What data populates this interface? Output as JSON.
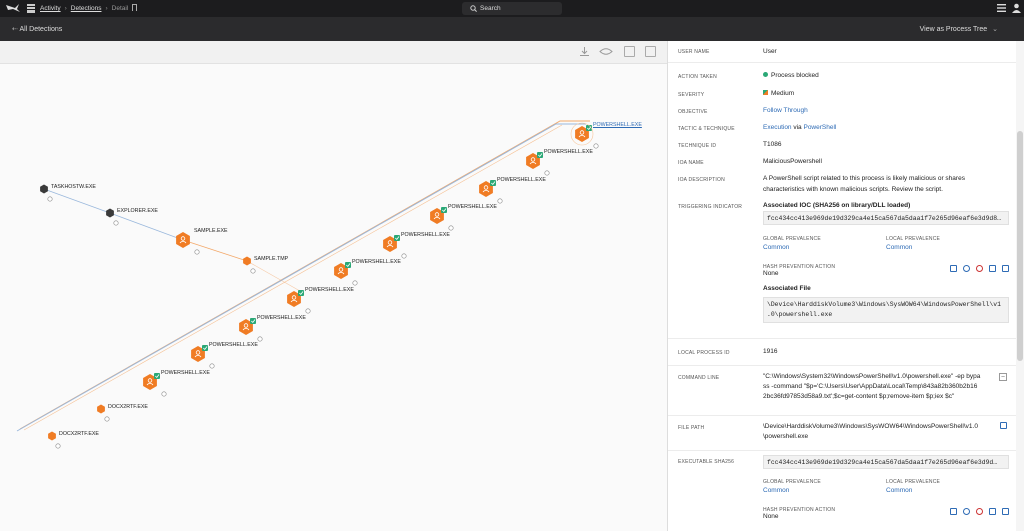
{
  "topbar": {
    "breadcrumb": [
      "Activity",
      "Detections",
      "Detail"
    ],
    "search_label": "Search"
  },
  "subbar": {
    "back_label": "All Detections",
    "view_label": "View as Process Tree"
  },
  "tree": {
    "nodes": [
      {
        "label": "TASKHOSTW.EXE",
        "kind": "gray"
      },
      {
        "label": "EXPLORER.EXE",
        "kind": "gray"
      },
      {
        "label": "SAMPLE.EXE",
        "kind": "orange"
      },
      {
        "label": "SAMPLE.TMP",
        "kind": "orange-small"
      },
      {
        "label": "POWERSHELL.EXE",
        "kind": "orange-check",
        "selected": true
      },
      {
        "label": "POWERSHELL.EXE",
        "kind": "orange-check"
      },
      {
        "label": "POWERSHELL.EXE",
        "kind": "orange-check"
      },
      {
        "label": "POWERSHELL.EXE",
        "kind": "orange-check"
      },
      {
        "label": "POWERSHELL.EXE",
        "kind": "orange-check"
      },
      {
        "label": "POWERSHELL.EXE",
        "kind": "orange-check"
      },
      {
        "label": "POWERSHELL.EXE",
        "kind": "orange-check"
      },
      {
        "label": "POWERSHELL.EXE",
        "kind": "orange-check"
      },
      {
        "label": "POWERSHELL.EXE",
        "kind": "orange-check"
      },
      {
        "label": "POWERSHELL.EXE",
        "kind": "orange-check"
      },
      {
        "label": "DOCX2RTF.EXE",
        "kind": "orange-small"
      },
      {
        "label": "DOCX2RTF.EXE",
        "kind": "orange-small"
      }
    ]
  },
  "details": {
    "user_name": {
      "key": "USER NAME",
      "value": "User"
    },
    "action_taken": {
      "key": "ACTION TAKEN",
      "value": "Process blocked"
    },
    "severity": {
      "key": "SEVERITY",
      "value": "Medium"
    },
    "objective": {
      "key": "OBJECTIVE",
      "value": "Follow Through"
    },
    "tactic": {
      "key": "TACTIC & TECHNIQUE",
      "tactic": "Execution",
      "via": "via",
      "technique": "PowerShell"
    },
    "technique_id": {
      "key": "TECHNIQUE ID",
      "value": "T1086"
    },
    "ioa_name": {
      "key": "IOA NAME",
      "value": "MaliciousPowershell"
    },
    "ioa_description": {
      "key": "IOA DESCRIPTION",
      "line1": "A PowerShell script related to this process is likely malicious or shares",
      "line2": "characteristics with known malicious scripts. Review the script."
    },
    "triggering_indicator": {
      "key": "TRIGGERING INDICATOR",
      "ioc_title": "Associated IOC (SHA256 on library/DLL loaded)",
      "ioc_hash": "fcc434cc413e969de19d329ca4e15ca567da5daa1f7e265d96eaf6e3d9d8…",
      "global_prevalence_label": "GLOBAL PREVALENCE",
      "global_prevalence": "Common",
      "local_prevalence_label": "LOCAL PREVALENCE",
      "local_prevalence": "Common",
      "hash_prevention_label": "HASH PREVENTION ACTION",
      "hash_prevention": "None",
      "assoc_file_title": "Associated File",
      "assoc_file_line1": "\\Device\\HarddiskVolume3\\Windows\\SysWOW64\\WindowsPowerShell\\v1",
      "assoc_file_line2": ".0\\powershell.exe"
    },
    "local_process_id": {
      "key": "LOCAL PROCESS ID",
      "value": "1916"
    },
    "command_line": {
      "key": "COMMAND LINE",
      "line1": "\"C:\\Windows\\System32\\WindowsPowerShell\\v1.0\\powershell.exe\" -ep bypa",
      "line2": "ss -command \"$p='C:\\Users\\User\\AppData\\Local\\Temp\\843a82b360b2b16",
      "line3": "2bc36fd97853d58a9.txt';$c=get-content $p;remove-item $p;iex $c\""
    },
    "file_path": {
      "key": "FILE PATH",
      "line1": "\\Device\\HarddiskVolume3\\Windows\\SysWOW64\\WindowsPowerShell\\v1.0",
      "line2": "\\powershell.exe"
    },
    "executable_sha256": {
      "key": "EXECUTABLE SHA256",
      "hash": "fcc434cc413e969de19d329ca4e15ca567da5daa1f7e265d96eaf6e3d9d…",
      "global_prevalence_label": "GLOBAL PREVALENCE",
      "global_prevalence": "Common",
      "local_prevalence_label": "LOCAL PREVALENCE",
      "local_prevalence": "Common",
      "hash_prevention_label": "HASH PREVENTION ACTION",
      "hash_prevention": "None"
    }
  },
  "colors": {
    "orange": "#f07c24",
    "green": "#2aa876",
    "blue": "#2e6bb5",
    "gray_node": "#3a3a3a",
    "edge_blue": "#9ab8dc",
    "edge_orange": "#f3a96b"
  }
}
